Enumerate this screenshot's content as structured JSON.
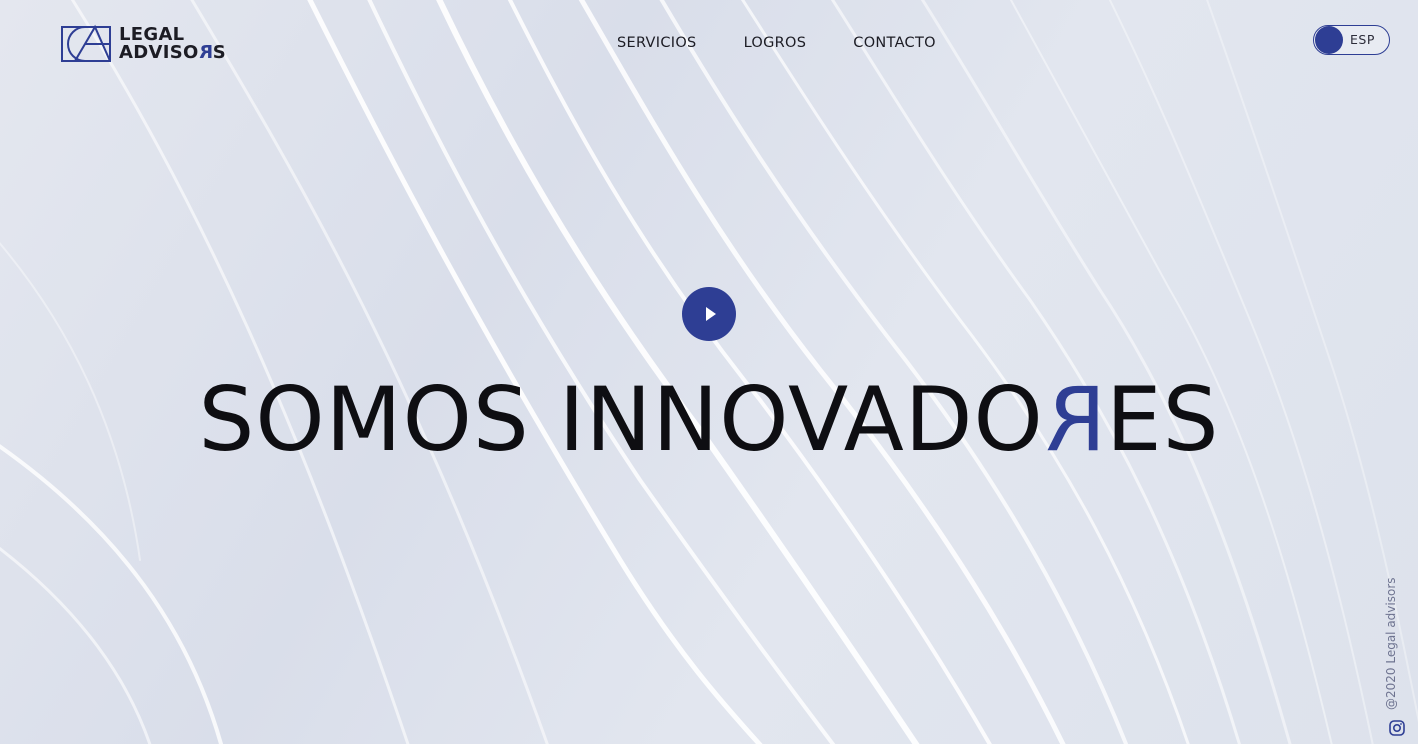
{
  "brand": {
    "line1": "LEGAL",
    "line2_main": "ADVISO",
    "line2_accent": "R",
    "line2_end": "S",
    "accent_color": "#2e3e94"
  },
  "nav": {
    "items": [
      {
        "label": "SERVICIOS"
      },
      {
        "label": "LOGROS"
      },
      {
        "label": "CONTACTO"
      }
    ]
  },
  "language": {
    "current": "ESP"
  },
  "hero": {
    "play_icon": "play-icon",
    "title_main": "SOMOS INNOVADO",
    "title_accent": "R",
    "title_end": "ES"
  },
  "footer": {
    "copyright": "@2020 Legal advisors",
    "social_icon": "instagram-icon"
  },
  "colors": {
    "accent": "#2e3e94",
    "text": "#0e0e12",
    "background": "#dde2ec"
  }
}
